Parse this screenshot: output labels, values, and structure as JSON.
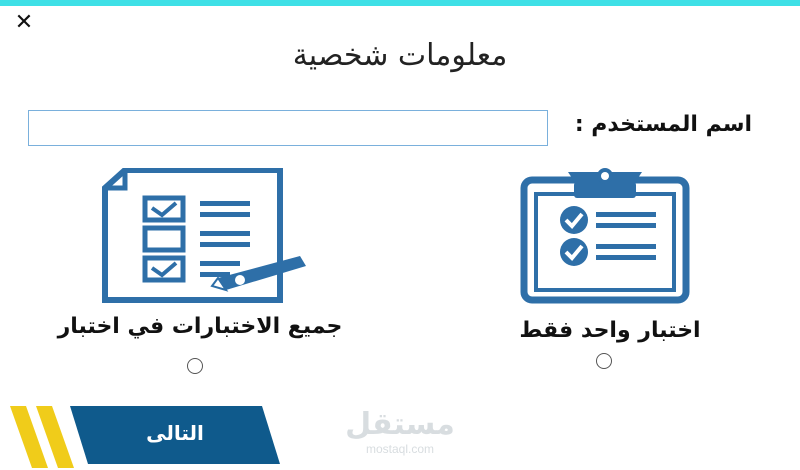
{
  "window": {
    "close_symbol": "✕",
    "title": "معلومات شخصية"
  },
  "form": {
    "username_label": "اسم المستخدم :",
    "username_value": "",
    "username_placeholder": ""
  },
  "options": [
    {
      "id": "all-tests",
      "label": "جميع الاختبارات في اختبار",
      "icon": "document-checklist-icon",
      "selected": false
    },
    {
      "id": "one-test",
      "label": "اختبار واحد فقط",
      "icon": "clipboard-checklist-icon",
      "selected": false
    }
  ],
  "actions": {
    "next_label": "التالى"
  },
  "watermark": {
    "logo": "مستقل",
    "url": "mostaql.com"
  },
  "colors": {
    "accent": "#3ee0e6",
    "icon_blue": "#2e6fa8",
    "button_blue": "#0f5a8c",
    "stripe_yellow": "#f0cc1a"
  }
}
